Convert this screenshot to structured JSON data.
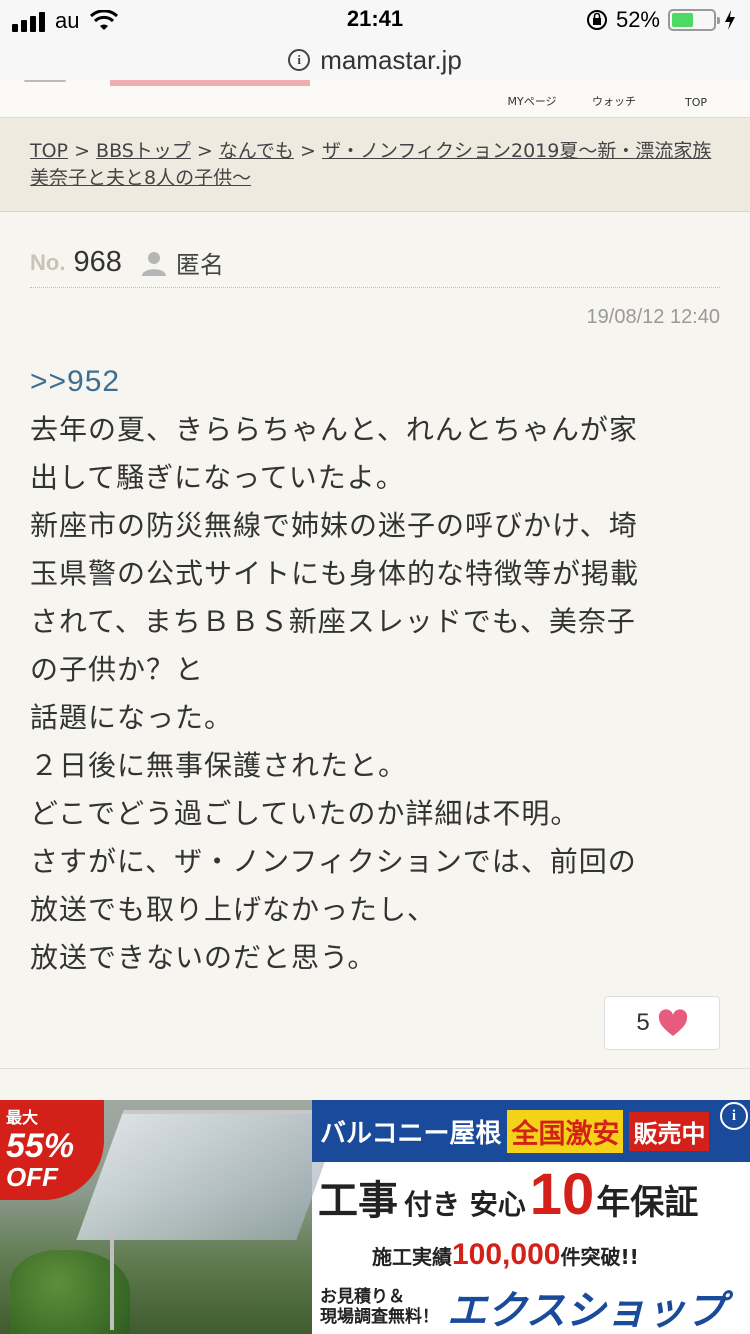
{
  "status_bar": {
    "carrier": "au",
    "time": "21:41",
    "battery_percent": "52%",
    "battery_level": 0.52
  },
  "browser": {
    "url": "mamastar.jp"
  },
  "site_nav": {
    "my_page": "MYページ",
    "watch": "ウォッチ",
    "top": "TOP"
  },
  "breadcrumb": {
    "items": [
      "TOP",
      "BBSトップ",
      "なんでも",
      "ザ・ノンフィクション2019夏〜新・漂流家族美奈子と夫と8人の子供〜"
    ],
    "separator": ">"
  },
  "post": {
    "no_label": "No.",
    "number": "968",
    "author": "匿名",
    "timestamp": "19/08/12 12:40",
    "reply_ref": ">>952",
    "lines": [
      "去年の夏、きららちゃんと、れんとちゃんが家",
      "出して騒ぎになっていたよ。",
      "新座市の防災無線で姉妹の迷子の呼びかけ、埼",
      "玉県警の公式サイトにも身体的な特徴等が掲載",
      "されて、まちＢＢＳ新座スレッドでも、美奈子",
      "の子供か？と",
      "話題になった。",
      "２日後に無事保護されたと。",
      "どこでどう過ごしていたのか詳細は不明。",
      "さすがに、ザ・ノンフィクションでは、前回の",
      "放送でも取り上げなかったし、",
      "放送できないのだと思う。"
    ],
    "likes": "5"
  },
  "ad": {
    "badge_top": "最大",
    "badge_percent": "55%",
    "badge_off": "OFF",
    "headline": "バルコニー屋根",
    "tag_cheap": "全国激安",
    "tag_sale": "販売中",
    "main_1": "工事",
    "main_2": "付き 安心",
    "main_num": "10",
    "main_3": "年保証",
    "sub_1": "施工実績",
    "sub_num": "100,000",
    "sub_2": "件突破!!",
    "quote_1": "お見積り＆",
    "quote_2": "現場調査無料！",
    "shop": "エクスショップ"
  },
  "colors": {
    "accent_link": "#3d6e94",
    "like_heart": "#e85a7e",
    "ad_blue": "#1a4a9a",
    "ad_red": "#d32018"
  }
}
